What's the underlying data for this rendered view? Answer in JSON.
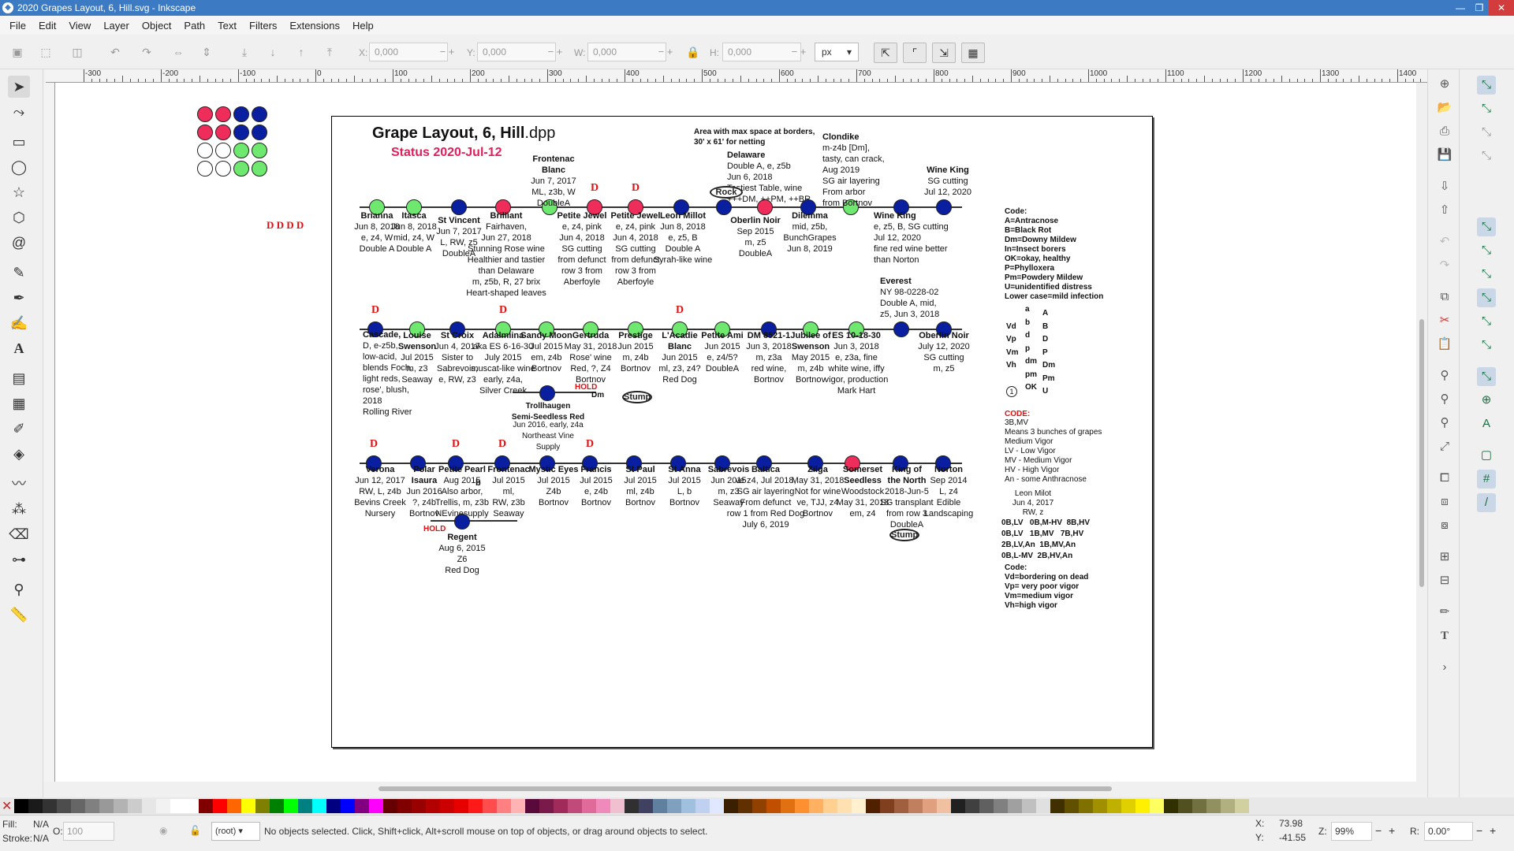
{
  "window": {
    "title": "2020 Grapes Layout, 6, Hill.svg - Inkscape"
  },
  "menu": [
    "File",
    "Edit",
    "View",
    "Layer",
    "Object",
    "Path",
    "Text",
    "Filters",
    "Extensions",
    "Help"
  ],
  "toolbar": {
    "x_label": "X:",
    "x_value": "0,000",
    "y_label": "Y:",
    "y_value": "0,000",
    "w_label": "W:",
    "w_value": "0,000",
    "h_label": "H:",
    "h_value": "0,000",
    "units": "px"
  },
  "ruler_ticks": [
    "-300",
    "-200",
    "-100",
    "0",
    "100",
    "200",
    "300",
    "400",
    "500",
    "600",
    "700",
    "800",
    "900",
    "1000",
    "1100",
    "1200",
    "1300",
    "1400"
  ],
  "drawing": {
    "title_main": "Grape Layout, 6, Hill",
    "title_ext": ".dpp",
    "status": "Status 2020-Jul-12",
    "net_note": "Area with max space at borders,\n30' x 61' for netting",
    "legend_d": "D D D D",
    "rock_label": "Rock",
    "stump_label": "Stump",
    "hold_label": "HOLD",
    "dm_label": "Dm",
    "row1": [
      {
        "name": "Brianna",
        "info": "Jun 8, 2018\ne, z4, W\nDouble A"
      },
      {
        "name": "Itasca",
        "info": "Jun 8, 2018\nmid, z4, W\nDouble A"
      },
      {
        "name": "St Vincent",
        "info": "Jun 7, 2017\nL, RW, z5\nDoubleA"
      },
      {
        "name": "Brilliant",
        "info": "Fairhaven,\nJun 27, 2018\nStunning Rose wine\nHealthier and tastier\nthan Delaware\nm, z5b, R, 27 brix\nHeart-shaped leaves"
      },
      {
        "name": "Frontenac\nBlanc",
        "info": "Jun 7, 2017\nML, z3b, W\nDoubleA"
      },
      {
        "name": "Petite Jewel",
        "info": "e, z4, pink\nJun 4, 2018\nSG cutting\nfrom defunct\nrow 3 from\nAberfoyle"
      },
      {
        "name": "Petite Jewel",
        "info": "e, z4, pink\nJun 4, 2018\nSG cutting\nfrom defunct\nrow 3 from\nAberfoyle"
      },
      {
        "name": "Leon Millot",
        "info": "Jun 8, 2018\ne, z5, B\nDouble A\nSyrah-like wine"
      },
      {
        "name": "Oberlin Noir",
        "info": "Sep 2015\nm, z5\nDoubleA"
      },
      {
        "name": "Delaware",
        "info": "Double A, e, z5b\nJun 6, 2018\nTastiest Table, wine\n+++DM, ++PM, ++BR"
      },
      {
        "name": "Dilemma",
        "info": "mid, z5b,\nBunchGrapes\nJun 8, 2019"
      },
      {
        "name": "Clondike",
        "info": "m-z4b [Dm],\ntasty, can crack,\nAug 2019\nSG air layering\nFrom arbor\nfrom Bortnov"
      },
      {
        "name": "Wine King",
        "info": "e, z5, B, SG cutting\nJul 12, 2020\nfine red wine better\nthan Norton"
      },
      {
        "name": "Wine King",
        "info": "SG cutting\nJul 12, 2020"
      }
    ],
    "row2": [
      {
        "name": "Cascade,",
        "info": "D, e-z5b,\nlow-acid,\nblends Foch,\nlight reds,\nrose', blush,\n2018\nRolling River"
      },
      {
        "name": "Louise\nSwenson",
        "info": "Jul 2015\nm, z3\nSeaway"
      },
      {
        "name": "St Croix",
        "info": "Jun 4, 2017\nSister to\nSabrevois,\ne, RW, z3"
      },
      {
        "name": "Adalmiina",
        "info": "aka ES 6-16-30\nJuly 2015\nmuscat-like wine\nearly, z4a,\nSilver Creek"
      },
      {
        "name": "Sandy Moon",
        "info": "Jul 2015\nem, z4b\nBortnov"
      },
      {
        "name": "Gertruda",
        "info": "May 31, 2018\nRose' wine\nRed, ?, Z4\nBortnov"
      },
      {
        "name": "Prestige",
        "info": "Jun 2015\nm, z4b\nBortnov"
      },
      {
        "name": "L'Acadie\nBlanc",
        "info": "Jun 2015\nml, z3, z4?\nRed Dog"
      },
      {
        "name": "Petite Ami",
        "info": "Jun 2015\ne, z4/5?\nDoubleA"
      },
      {
        "name": "DM 8521-1",
        "info": "Jun 3, 2018\nm, z3a\nred wine,\nBortnov"
      },
      {
        "name": "Jubilee of\nSwenson",
        "info": "May 2015\nm, z4b\nBortnov"
      },
      {
        "name": "ES 10-18-30",
        "info": "Jun 3, 2018\ne, z3a, fine\nwhite wine, iffy\nvigor, production\nMark Hart"
      },
      {
        "name": "Everest",
        "info": "NY 98-0228-02\nDouble A, mid,\nz5, Jun 3, 2018"
      },
      {
        "name": "Oberlin Noir",
        "info": "July 12, 2020\nSG cutting\nm, z5"
      }
    ],
    "trollhaugen": {
      "name": "Trollhaugen\nSemi-Seedless Red",
      "info": "Jun 2016, early, z4a\nNortheast Vine\nSupply"
    },
    "row3": [
      {
        "name": "Verona",
        "info": "Jun 12, 2017\nRW, L, z4b\nBevins Creek\nNursery"
      },
      {
        "name": "Polar\nIsaura",
        "info": "Jun 2016\n?, z4b\nBortnov"
      },
      {
        "name": "Petite Pearl",
        "info": "Aug 2015\nAlso arbor,\nTrellis, m, z3b\nNEvinesupply"
      },
      {
        "name": "Frontenac",
        "info": "Jul 2015\nml,\nRW, z3b\nSeaway"
      },
      {
        "name": "Mystic Eyes",
        "info": "Jul 2015\nZ4b\nBortnov"
      },
      {
        "name": "Francis",
        "info": "Jul 2015\ne, z4b\nBortnov"
      },
      {
        "name": "St Paul",
        "info": "Jul 2015\nml, z4b\nBortnov"
      },
      {
        "name": "St Anna",
        "info": "Jul 2015\nL, b\nBortnov"
      },
      {
        "name": "Sabrevois",
        "info": "Jun 2015\nm, z3\nSeaway"
      },
      {
        "name": "Baltica",
        "info": "ve z4, Jul 2018,\nSG air layering\nFrom defunct\nrow 1 from Red Dog\nJuly 6, 2019"
      },
      {
        "name": "Zilga",
        "info": "May 31, 2018\nNot for wine\nve, TJJ, z4\nBortnov"
      },
      {
        "name": "Somerset\nSeedless",
        "info": "Woodstock\nMay 31, 2018\nem, z4"
      },
      {
        "name": "King of\nthe North",
        "info": "2018-Jun-5\nSG transplant\nfrom row 3\nDoubleA\nm, z3"
      },
      {
        "name": "Norton",
        "info": "Sep 2014\nL, z4\nEdible\nLandscaping"
      }
    ],
    "petite_pearl_b": "b",
    "regent": {
      "name": "Regent",
      "info": "Aug 6, 2015\nZ6\nRed Dog"
    },
    "code_block": "Code:\nA=Antracnose\nB=Black Rot\nDm=Downy Mildew\nIn=Insect borers\nOK=okay, healthy\nP=Phylloxera\nPm=Powdery Mildew\nU=unidentified distress\nLower case=mild infection",
    "legend_rows": [
      {
        "v": "",
        "a": "a",
        "b": "A"
      },
      {
        "v": "Vd",
        "a": "b",
        "b": "B"
      },
      {
        "v": "Vp",
        "a": "d",
        "b": "D"
      },
      {
        "v": "Vm",
        "a": "p",
        "b": "P"
      },
      {
        "v": "Vh",
        "a": "dm",
        "b": "Dm"
      },
      {
        "v": "",
        "a": "pm",
        "b": "Pm"
      },
      {
        "v": "1",
        "a": "OK",
        "b": "U"
      }
    ],
    "code2_title": "CODE:",
    "code2_block": "3B,MV\nMeans 3 bunches of grapes\nMedium Vigor\nLV - Low Vigor\nMV - Medium Vigor\nHV - High Vigor\nAn - some Anthracnose",
    "leon_block": "Leon Milot\nJun 4, 2017\nRW, z",
    "vigor_grid": "0B,LV   0B,M-HV  8B,HV\n0B,LV   1B,MV   7B,HV\n2B,LV,An  1B,MV,An\n0B,L-MV  2B,HV,An",
    "code3_block": "Code:\nVd=bordering on dead\nVp= very poor vigor\nVm=medium vigor\nVh=high vigor"
  },
  "status": {
    "fill_label": "Fill:",
    "fill_value": "N/A",
    "stroke_label": "Stroke:",
    "stroke_value": "N/A",
    "opacity_label": "O:",
    "opacity_value": "100",
    "layer": "(root)",
    "message": "No objects selected. Click, Shift+click, Alt+scroll mouse on top of objects, or drag around objects to select.",
    "x_label": "X:",
    "x_value": "73.98",
    "y_label": "Y:",
    "y_value": "-41.55",
    "zoom_label": "Z:",
    "zoom_value": "99%",
    "rot_label": "R:",
    "rot_value": "0.00°"
  },
  "colors": {
    "green": "#6ee86e",
    "blue": "#0a1ea0",
    "red": "#ef2d5a",
    "d_mark": "#e01010"
  }
}
